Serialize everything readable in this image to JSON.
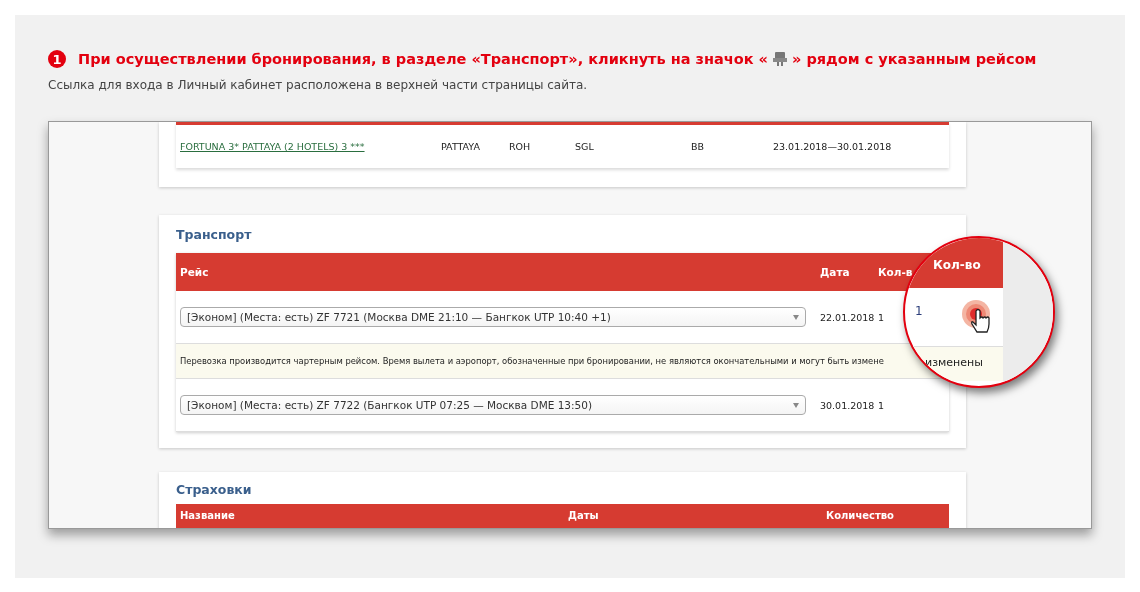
{
  "instruction": {
    "step": "1",
    "text_before": "При осуществлении бронирования, в разделе «Транспорт», кликнуть на значок «",
    "text_after": "» рядом с указанным рейсом",
    "subtitle": "Ссылка для входа в Личный кабинет расположена в верхней части страницы сайта."
  },
  "hotel_row": {
    "name": "FORTUNA 3* PATTAYA (2 HOTELS) 3 ***",
    "cells": [
      "PATTAYA",
      "ROH",
      "SGL",
      "BB",
      "23.01.2018—30.01.2018"
    ]
  },
  "transport": {
    "title": "Транспорт",
    "columns": [
      "Рейс",
      "Дата",
      "Кол-в"
    ],
    "rows": [
      {
        "kind": "flight",
        "flight": "[Эконом] (Места: есть) ZF 7721 (Москва DME 21:10 — Бангкок UTP 10:40 +1)",
        "date": "22.01.2018",
        "qty": "1"
      },
      {
        "kind": "note",
        "text": "Перевозка производится чартерным рейсом. Время вылета и аэропорт, обозначенные при бронировании, не являются окончательными и могут быть измене"
      },
      {
        "kind": "flight",
        "flight": "[Эконом] (Места: есть) ZF 7722 (Бангкок UTP 07:25 — Москва DME 13:50)",
        "date": "30.01.2018",
        "qty": "1"
      }
    ]
  },
  "insurance": {
    "title": "Страховки",
    "columns": [
      "Название",
      "Даты",
      "Количество"
    ]
  },
  "magnifier": {
    "column": "Кол-во",
    "qty": "1",
    "note_end": "изменены"
  }
}
